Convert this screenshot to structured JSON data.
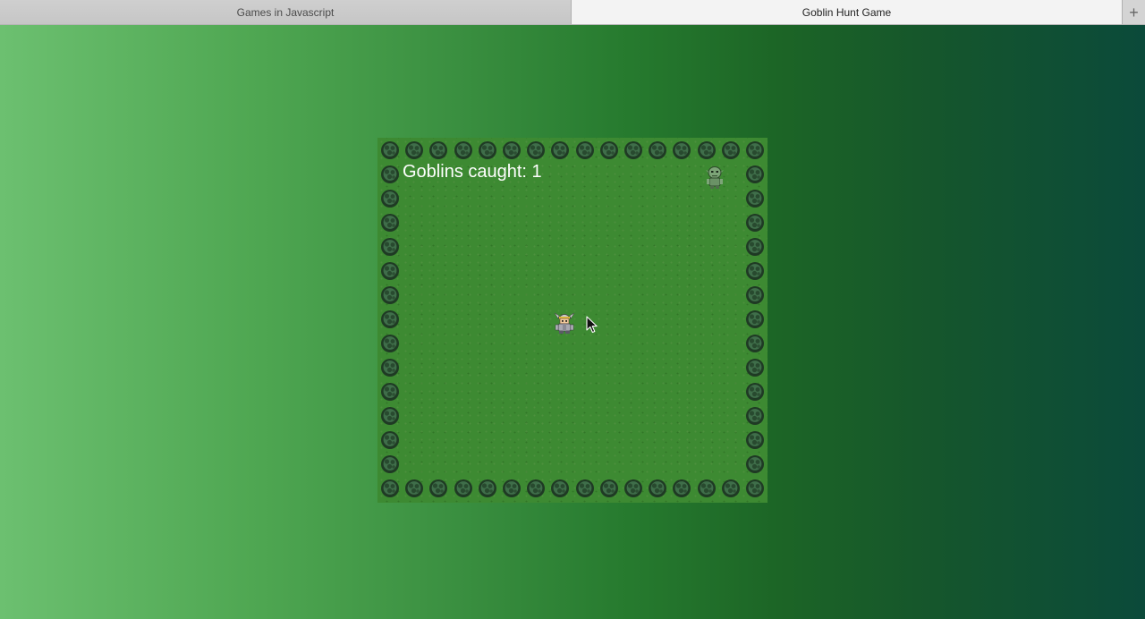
{
  "tabs": [
    {
      "label": "Games in Javascript",
      "active": false
    },
    {
      "label": "Goblin Hunt Game",
      "active": true
    }
  ],
  "new_tab_icon": "plus-icon",
  "game": {
    "score_label": "Goblins caught: 1",
    "goblins_caught": 1,
    "colors": {
      "grass": "#3d8a32",
      "tree_dark": "#1f3a24",
      "tree_light": "#3f6e4a",
      "score_text": "#ffffff"
    }
  }
}
